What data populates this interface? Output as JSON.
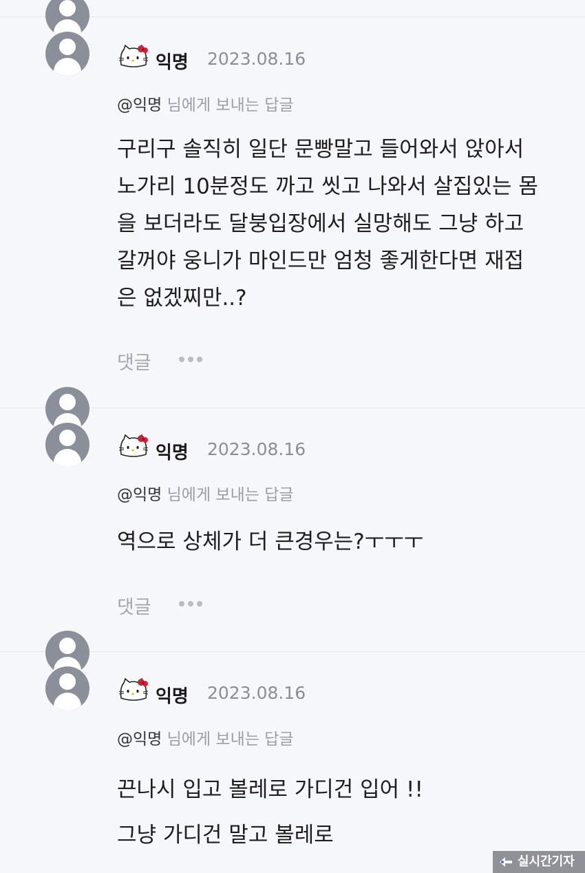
{
  "comments": [
    {
      "author": "익명",
      "date": "2023.08.16",
      "mention": "@익명",
      "reply_suffix": "님에게 보내는 답글",
      "lines": [
        "구리구 솔직히 일단 문빵말고 들어와서 앉아서",
        "노가리 10분정도 까고 씻고 나와서 살집있는 몸",
        "을 보더라도 달붕입장에서 실망해도 그냥 하고",
        "갈꺼야 웅니가 마인드만 엄청 좋게한다면 재접",
        "은 없겠찌만..?"
      ],
      "reply_action": "댓글"
    },
    {
      "author": "익명",
      "date": "2023.08.16",
      "mention": "@익명",
      "reply_suffix": "님에게 보내는 답글",
      "lines": [
        "역으로 상체가 더 큰경우는?ㅜㅜㅜ"
      ],
      "reply_action": "댓글"
    },
    {
      "author": "익명",
      "date": "2023.08.16",
      "mention": "@익명",
      "reply_suffix": "님에게 보내는 답글",
      "lines": [
        "끈나시 입고 볼레로 가디건 입어 !!",
        "그냥 가디건 말고 볼레로"
      ]
    }
  ],
  "watermark": {
    "text": "실시간기자"
  },
  "icons": {
    "avatar": "user-avatar-icon",
    "badge": "hello-kitty-icon",
    "more": "more-dots-icon"
  }
}
